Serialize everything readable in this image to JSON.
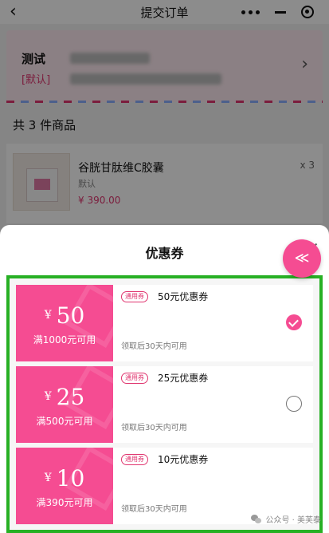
{
  "header": {
    "title": "提交订单",
    "back_icon": "chevron-left-icon",
    "more_icon": "more-dots-icon",
    "minimize_icon": "minimize-icon",
    "close_icon": "close-circle-icon"
  },
  "address": {
    "name": "测试",
    "default_tag": "[默认]"
  },
  "order": {
    "items_count": "共 3 件商品",
    "product": {
      "name": "谷胱甘肽维C胶囊",
      "spec": "默认",
      "price": "¥ 390.00",
      "qty": "x 3"
    }
  },
  "coupon_sheet": {
    "title": "优惠券",
    "close_icon": "close-icon",
    "accent": "#f54c92",
    "frame_color": "#27b024",
    "coupons": [
      {
        "currency": "¥",
        "amount": "50",
        "condition": "满1000元可用",
        "badge": "通用券",
        "name": "50元优惠券",
        "validity": "领取后30天内可用",
        "selected": true
      },
      {
        "currency": "¥",
        "amount": "25",
        "condition": "满500元可用",
        "badge": "通用券",
        "name": "25元优惠券",
        "validity": "领取后30天内可用",
        "selected": false
      },
      {
        "currency": "¥",
        "amount": "10",
        "condition": "满390元可用",
        "badge": "通用券",
        "name": "10元优惠券",
        "validity": "领取后30天内可用",
        "selected": false
      }
    ]
  },
  "fab": {
    "icon": "scroll-up-icon",
    "glyph": "≪"
  },
  "watermark": {
    "text": "公众号 · 美芙泰",
    "icon": "wechat-icon"
  }
}
